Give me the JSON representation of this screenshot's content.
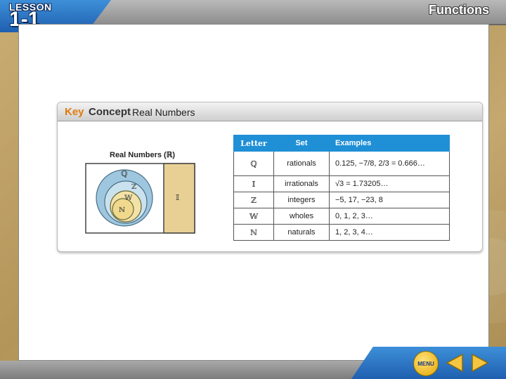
{
  "header": {
    "lesson_word": "LESSON",
    "lesson_number": "1-1",
    "chapter_title": "Functions"
  },
  "key_concept": {
    "key": "Key",
    "concept": "Concept",
    "title": "Real Numbers",
    "venn": {
      "label": "Real Numbers (ℝ)",
      "sets": [
        "ℚ",
        "ℤ",
        "𝕎",
        "ℕ"
      ],
      "irrational_label": "𝕀"
    },
    "table": {
      "headers": [
        "Letter",
        "Set",
        "Examples"
      ],
      "rows": [
        {
          "letter": "ℚ",
          "set": "rationals",
          "example": "0.125, −7/8, 2/3 = 0.666…"
        },
        {
          "letter": "𝕀",
          "set": "irrationals",
          "example": "√3 = 1.73205…"
        },
        {
          "letter": "ℤ",
          "set": "integers",
          "example": "−5, 17, −23, 8"
        },
        {
          "letter": "𝕎",
          "set": "wholes",
          "example": "0, 1, 2, 3…"
        },
        {
          "letter": "ℕ",
          "set": "naturals",
          "example": "1, 2, 3, 4…"
        }
      ]
    }
  },
  "nav": {
    "menu_label": "MENU",
    "prev_icon": "left-arrow-icon",
    "next_icon": "right-arrow-icon"
  },
  "colors": {
    "accent_blue": "#1f8fd6",
    "key_orange": "#e07a10",
    "venn_q": "#9ec7df",
    "venn_n": "#f3e2a8",
    "venn_i": "#e8d095"
  }
}
